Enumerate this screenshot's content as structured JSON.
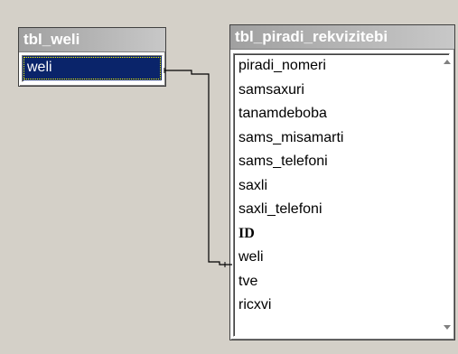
{
  "tables": {
    "weli": {
      "title": "tbl_weli",
      "fields": [
        "weli"
      ],
      "selected_field": "weli"
    },
    "piradi": {
      "title": "tbl_piradi_rekvizitebi",
      "fields": [
        {
          "name": "piradi_nomeri",
          "key": false
        },
        {
          "name": "samsaxuri",
          "key": false
        },
        {
          "name": "tanamdeboba",
          "key": false
        },
        {
          "name": "sams_misamarti",
          "key": false
        },
        {
          "name": "sams_telefoni",
          "key": false
        },
        {
          "name": "saxli",
          "key": false
        },
        {
          "name": "saxli_telefoni",
          "key": false
        },
        {
          "name": "ID",
          "key": true
        },
        {
          "name": "weli",
          "key": false
        },
        {
          "name": "tve",
          "key": false
        },
        {
          "name": "ricxvi",
          "key": false
        }
      ]
    }
  },
  "relationship": {
    "from": "tbl_weli.weli",
    "to": "tbl_piradi_rekvizitebi.weli"
  },
  "colors": {
    "background": "#d4d0c8",
    "title_bar": "#a0a0a0",
    "selection": "#0a246a",
    "line": "#000000"
  }
}
